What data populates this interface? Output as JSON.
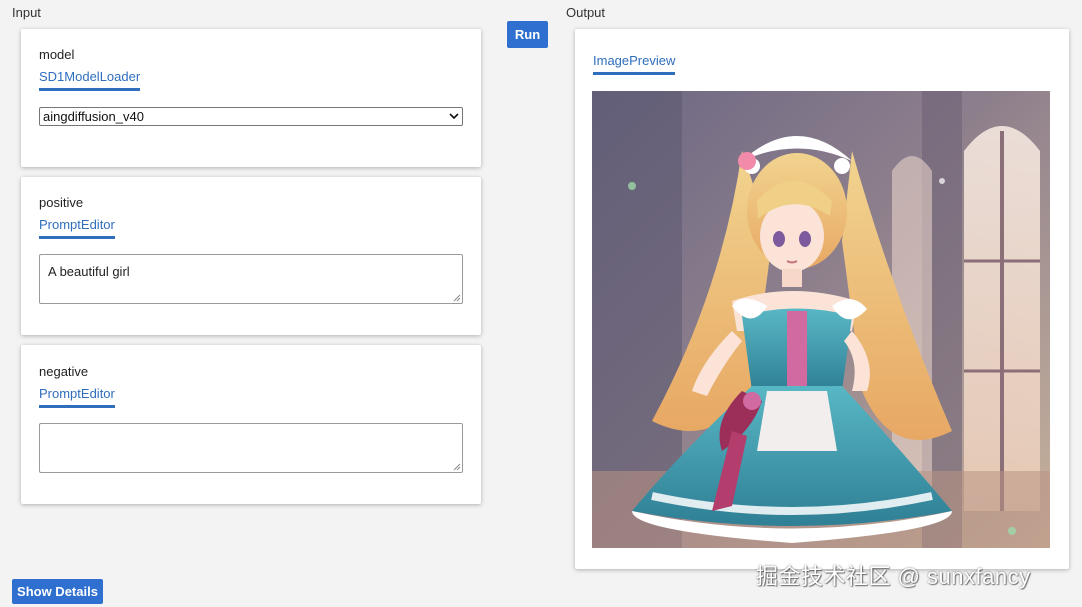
{
  "sections": {
    "input_label": "Input",
    "output_label": "Output"
  },
  "model_card": {
    "title": "model",
    "tab": "SD1ModelLoader",
    "selected_model": "aingdiffusion_v40"
  },
  "positive_card": {
    "title": "positive",
    "tab": "PromptEditor",
    "value": "A beautiful girl"
  },
  "negative_card": {
    "title": "negative",
    "tab": "PromptEditor",
    "value": ""
  },
  "output_card": {
    "tab": "ImagePreview"
  },
  "buttons": {
    "run": "Run",
    "show_details": "Show Details"
  },
  "watermark": "掘金技术社区 @ sunxfancy",
  "colors": {
    "accent": "#2f6fcf",
    "tab_text": "#2f6ebd",
    "background": "#f3f3f3"
  }
}
